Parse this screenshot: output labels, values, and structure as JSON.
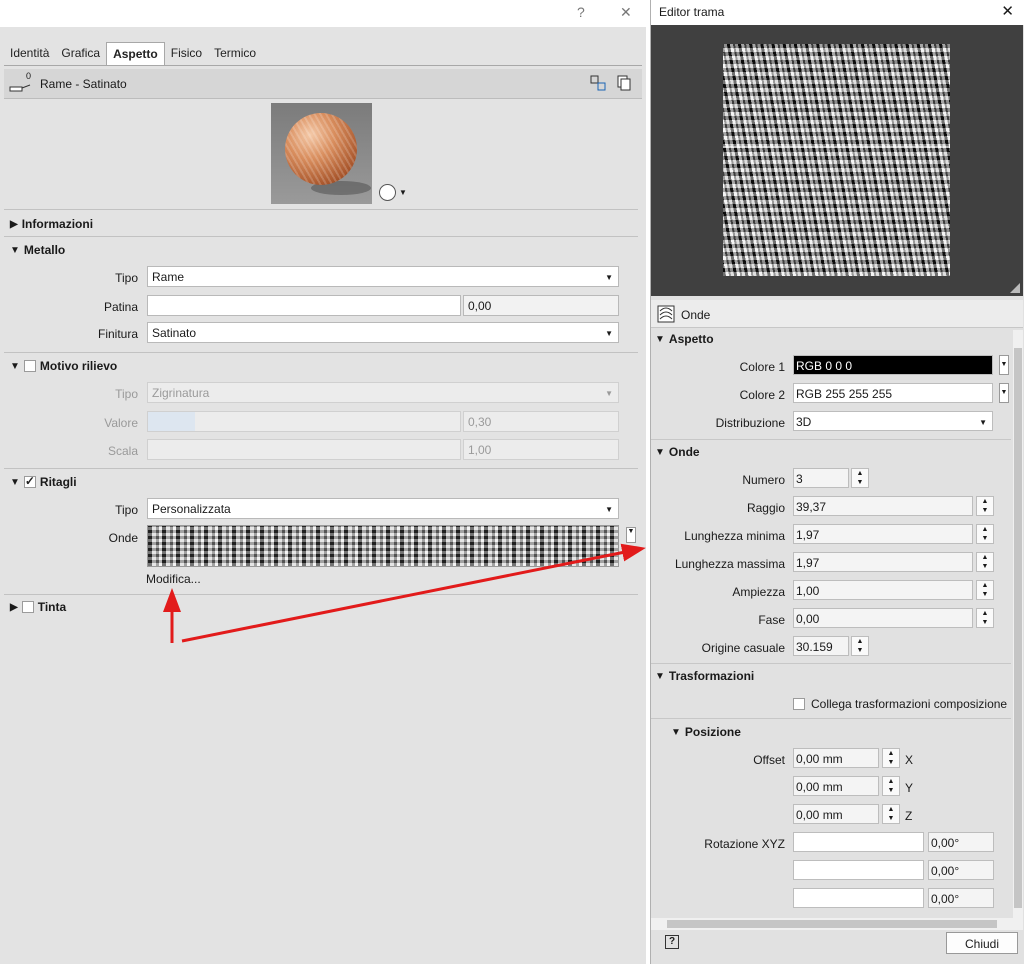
{
  "left": {
    "help_glyph": "?",
    "close_glyph": "✕",
    "tabs": [
      "Identità",
      "Grafica",
      "Aspetto",
      "Fisico",
      "Termico"
    ],
    "active_tab": "Aspetto",
    "material_count": "0",
    "material_name": "Rame - Satinato",
    "sections": {
      "informazioni": "Informazioni",
      "metallo": "Metallo",
      "motivo": "Motivo rilievo",
      "ritagli": "Ritagli",
      "tinta": "Tinta"
    },
    "metallo": {
      "tipo_label": "Tipo",
      "tipo_value": "Rame",
      "patina_label": "Patina",
      "patina_value": "",
      "patina_num": "0,00",
      "finitura_label": "Finitura",
      "finitura_value": "Satinato"
    },
    "motivo": {
      "tipo_label": "Tipo",
      "tipo_value": "Zigrinatura",
      "valore_label": "Valore",
      "valore_num": "0,30",
      "valore_fill": 0.15,
      "scala_label": "Scala",
      "scala_num": "1,00"
    },
    "ritagli": {
      "tipo_label": "Tipo",
      "tipo_value": "Personalizzata",
      "onde_label": "Onde",
      "modifica_link": "Modifica..."
    }
  },
  "right": {
    "title": "Editor trama",
    "close_glyph": "✕",
    "texture_name": "Onde",
    "aspetto": {
      "section": "Aspetto",
      "colore1_label": "Colore 1",
      "colore1_value": "RGB 0 0 0",
      "colore2_label": "Colore 2",
      "colore2_value": "RGB 255 255 255",
      "distribuzione_label": "Distribuzione",
      "distribuzione_value": "3D"
    },
    "onde": {
      "section": "Onde",
      "numero_label": "Numero",
      "numero_value": "3",
      "raggio_label": "Raggio",
      "raggio_value": "39,37",
      "lmin_label": "Lunghezza minima",
      "lmin_value": "1,97",
      "lmax_label": "Lunghezza massima",
      "lmax_value": "1,97",
      "ampiezza_label": "Ampiezza",
      "ampiezza_value": "1,00",
      "fase_label": "Fase",
      "fase_value": "0,00",
      "origine_label": "Origine casuale",
      "origine_value": "30.159"
    },
    "trasformazioni": {
      "section": "Trasformazioni",
      "collega_label": "Collega trasformazioni composizione"
    },
    "posizione": {
      "section": "Posizione",
      "offset_label": "Offset",
      "offset_x": "0,00 mm",
      "offset_y": "0,00 mm",
      "offset_z": "0,00 mm",
      "axis_x": "X",
      "axis_y": "Y",
      "axis_z": "Z",
      "rotazione_label": "Rotazione XYZ",
      "rot_x": "0,00°",
      "rot_y": "0,00°",
      "rot_z": "0,00°"
    },
    "help_glyph": "?",
    "chiudi": "Chiudi"
  }
}
